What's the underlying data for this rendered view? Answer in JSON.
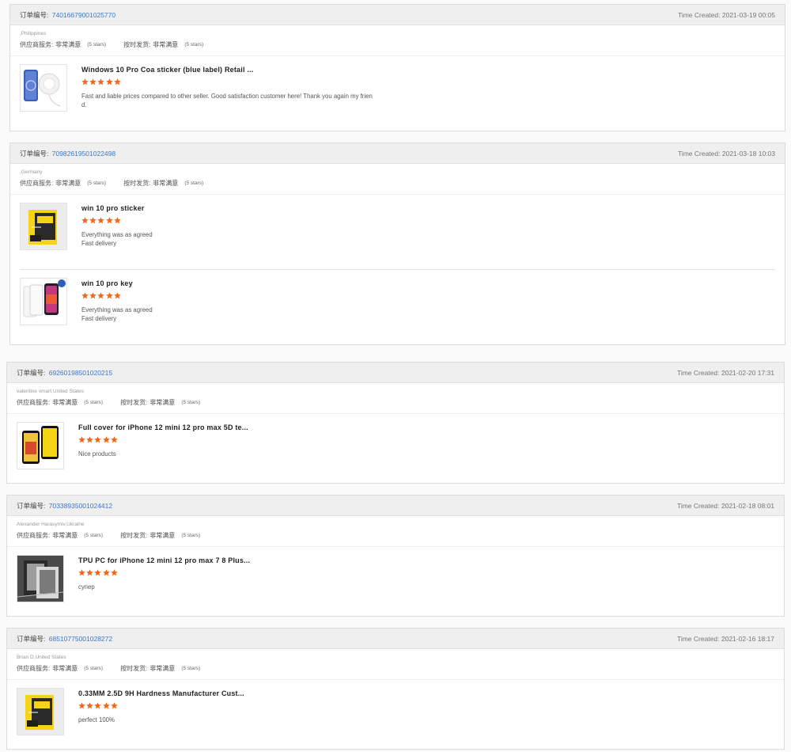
{
  "labels": {
    "order_no": "订单编号:",
    "time_created": "Time Created:",
    "supplier_service": "供应商服务:",
    "on_time_shipping": "按时发货:",
    "very_satisfied": "非常满意",
    "five_stars": "(5 stars)"
  },
  "colors": {
    "accent_link": "#3a78c8",
    "star": "#f06a1e",
    "header_bg": "#efefef"
  },
  "orders": [
    {
      "order_no": "74016679001025770",
      "time": "2021-03-19 00:05",
      "buyer": ",Philippines",
      "products": [
        {
          "title": "Windows 10 Pro Coa sticker (blue label) Retail ...",
          "rating": 5,
          "comment": "Fast and liable prices compared to other seller. Good satisfaction customer here! Thank you again my frien\nd.",
          "thumb_icon": "phone-magsafe-charger-image"
        }
      ]
    },
    {
      "order_no": "70982619501022498",
      "time": "2021-03-18 10:03",
      "buyer": ",Germany",
      "products": [
        {
          "title": "win 10 pro sticker",
          "rating": 5,
          "comment": "Everything was as agreed\nFast delivery",
          "thumb_icon": "tempered-glass-box-image"
        },
        {
          "title": "win 10 pro key",
          "rating": 5,
          "comment": "Everything was as agreed\nFast delivery",
          "thumb_icon": "iphone-screen-protector-image"
        }
      ]
    },
    {
      "order_no": "69260198501020215",
      "time": "2021-02-20 17:31",
      "buyer": "valentine vmart,United States",
      "products": [
        {
          "title": "Full cover for iPhone 12 mini 12 pro max 5D te...",
          "rating": 5,
          "comment": "Nice products",
          "thumb_icon": "full-cover-glass-image"
        }
      ]
    },
    {
      "order_no": "70338935001024412",
      "time": "2021-02-18 08:01",
      "buyer": "Alexander Harasymiv,Ukraine",
      "products": [
        {
          "title": "TPU PC for iPhone 12 mini 12 pro max 7 8 Plus...",
          "rating": 5,
          "comment": "супер",
          "thumb_icon": "tpu-case-photo-image"
        }
      ]
    },
    {
      "order_no": "68510775001028272",
      "time": "2021-02-16 18:17",
      "buyer": "Brian D,United States",
      "products": [
        {
          "title": "0.33MM 2.5D 9H Hardness Manufacturer Cust...",
          "rating": 5,
          "comment": "perfect 100%",
          "thumb_icon": "tempered-glass-box-image"
        }
      ]
    }
  ]
}
